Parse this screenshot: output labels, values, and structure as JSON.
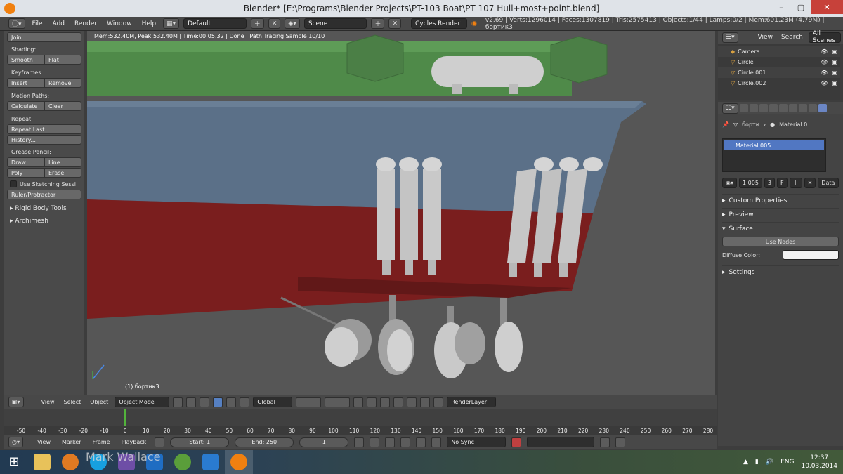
{
  "window": {
    "title": "Blender* [E:\\Programs\\Blender Projects\\PT-103 Boat\\PT 107 Hull+most+point.blend]",
    "controls": [
      "–",
      "▢",
      "✕"
    ]
  },
  "info_header": {
    "menus": [
      "File",
      "Add",
      "Render",
      "Window",
      "Help"
    ],
    "screen_layout": "Default",
    "scene": "Scene",
    "render_engine": "Cycles Render",
    "stats": "v2.69 | Verts:1296014 | Faces:1307819 | Tris:2575413 | Objects:1/44 | Lamps:0/2 | Mem:601.23M (4.79M) | бортик3"
  },
  "tool_shelf": {
    "join_label": "Join",
    "shading": {
      "label": "Shading:",
      "smooth": "Smooth",
      "flat": "Flat"
    },
    "keyframes": {
      "label": "Keyframes:",
      "insert": "Insert",
      "remove": "Remove"
    },
    "motion_paths": {
      "label": "Motion Paths:",
      "calculate": "Calculate",
      "clear": "Clear"
    },
    "repeat": {
      "label": "Repeat:",
      "repeat_last": "Repeat Last",
      "history": "History..."
    },
    "grease_pencil": {
      "label": "Grease Pencil:",
      "draw": "Draw",
      "line": "Line",
      "poly": "Poly",
      "erase": "Erase",
      "sketching": "Use Sketching Sessi",
      "ruler": "Ruler/Protractor"
    },
    "panels": [
      "Rigid Body Tools",
      "Archimesh"
    ]
  },
  "viewport": {
    "render_stats": "Mem:532.40M, Peak:532.40M | Time:00:05.32 | Done | Path Tracing Sample 10/10",
    "object_name": "(1) бортик3"
  },
  "outliner": {
    "menus": [
      "View",
      "Search"
    ],
    "filter": "All Scenes",
    "items": [
      {
        "name": "Camera"
      },
      {
        "name": "Circle"
      },
      {
        "name": "Circle.001"
      },
      {
        "name": "Circle.002"
      }
    ]
  },
  "properties": {
    "breadcrumb_object": "борти",
    "breadcrumb_material": "Material.0",
    "material_slot": "Material.005",
    "datablock_name": "1.005",
    "users": "3",
    "fake_user": "F",
    "link_mode": "Data",
    "sections": {
      "custom_properties": "Custom Properties",
      "preview": "Preview",
      "surface": "Surface",
      "settings": "Settings"
    },
    "use_nodes": "Use Nodes",
    "diffuse_color_label": "Diffuse Color:",
    "diffuse_color": "#f2f2f2"
  },
  "viewport_footer": {
    "menus": [
      "View",
      "Select",
      "Object"
    ],
    "mode": "Object Mode",
    "orientation": "Global",
    "render_layer": "RenderLayer"
  },
  "timeline": {
    "ticks": [
      "-50",
      "-40",
      "-30",
      "-20",
      "-10",
      "0",
      "10",
      "20",
      "30",
      "40",
      "50",
      "60",
      "70",
      "80",
      "90",
      "100",
      "110",
      "120",
      "130",
      "140",
      "150",
      "160",
      "170",
      "180",
      "190",
      "200",
      "210",
      "220",
      "230",
      "240",
      "250",
      "260",
      "270",
      "280"
    ],
    "current_frame_marker": 0
  },
  "timeline_footer": {
    "menus": [
      "View",
      "Marker",
      "Frame",
      "Playback"
    ],
    "start": "Start: 1",
    "end": "End: 250",
    "current_frame": "1",
    "sync": "No Sync"
  },
  "taskbar": {
    "watermark": "Mark Wallace",
    "language": "ENG",
    "time": "12:37",
    "date": "10.03.2014"
  }
}
